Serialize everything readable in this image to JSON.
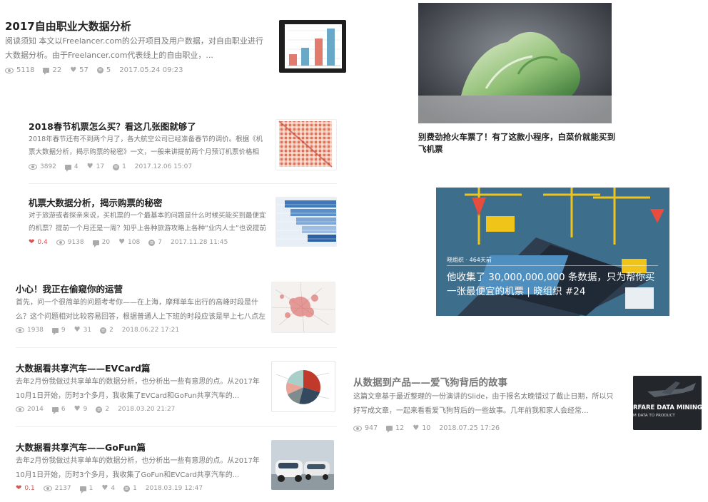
{
  "left_articles": [
    {
      "title": "2017自由职业大数据分析",
      "excerpt": "阅读须知 本文以Freelancer.com的公开项目及用户数据，对自由职业进行大数据分析。由于Freelancer.com代表线上的自由职业，...",
      "views": "5118",
      "comments": "22",
      "likes": "57",
      "shares": "5",
      "date": "2017.05.24 09:23"
    },
    {
      "title": "2018春节机票怎么买？看这几张图就够了",
      "excerpt": "2018年春节还有不到两个月了，各大航空公司已经准备春节的调价。根据《机票大数据分析，揭示购票的秘密》一文，一般来讲提前两个月预订机票价格相对较...",
      "views": "3892",
      "comments": "4",
      "likes": "17",
      "shares": "1",
      "date": "2017.12.06 15:07"
    },
    {
      "title": "机票大数据分析，揭示购票的秘密",
      "excerpt": "对于旅游或者探亲来说，买机票的一个最基本的问题是什么时候买能买到最便宜的机票？提前一个月还是一周？知乎上各种旅游攻略上各种“业内人士”也说提前一...",
      "hot": "0.4",
      "views": "9138",
      "comments": "20",
      "likes": "108",
      "shares": "7",
      "date": "2017.11.28 11:45"
    },
    {
      "title": "小心！我正在偷窥你的运营",
      "excerpt": "首先，问一个很简单的问题考考你——在上海，摩拜单车出行的高峰时段是什么？这个问题相对比较容易回答，根据普通人上下班的时段应该是早上七八点左右，下...",
      "views": "1938",
      "comments": "9",
      "likes": "31",
      "shares": "2",
      "date": "2018.06.22 17:21"
    },
    {
      "title": "大数据看共享汽车——EVCard篇",
      "excerpt": "去年2月份我做过共享单车的数据分析，也分析出一些有意思的点。从2017年10月1日开始，历时3个多月，我收集了EVCard和GoFun共享汽车的...",
      "views": "2014",
      "comments": "6",
      "likes": "9",
      "shares": "2",
      "date": "2018.03.20 21:27"
    },
    {
      "title": "大数据看共享汽车——GoFun篇",
      "excerpt": "去年2月份我做过共享单车的数据分析，也分析出一些有意思的点。从2017年10月1日开始，历时3个多月，我收集了GoFun和EVCard共享汽车的...",
      "hot": "0.1",
      "views": "2137",
      "comments": "1",
      "likes": "4",
      "shares": "1",
      "date": "2018.03.19 12:47"
    }
  ],
  "right_cabbage": {
    "title": "别费劲抢火车票了！有了这款小程序，白菜价就能买到飞机票"
  },
  "right_banner": {
    "meta": "晓组织 · 464天前",
    "title": "他收集了 30,000,000,000 条数据，只为帮你买一张最便宜的机票 | 晓组织 #24"
  },
  "right_article": {
    "title": "从数据到产品——爱飞狗背后的故事",
    "excerpt": "这篇文章基于最近整理的一份演讲的Slide，由于报名太晚错过了截止日期，所以只好写成文章，一起来看看爱飞狗背后的一些故事。几年前我和家人会经常...",
    "views": "947",
    "comments": "12",
    "likes": "10",
    "date": "2018.07.25 17:26",
    "thumb_line1": "RFARE DATA MINING",
    "thumb_line2": "M DATA TO PRODUCT"
  },
  "chart_thumb": {
    "ticks": [
      "",
      "",
      "",
      ""
    ],
    "labels": [
      "",
      ""
    ]
  },
  "colors": {
    "accent": "#d9534f",
    "bar1": "#e07b6e",
    "bar2": "#6aa8c7",
    "bar3": "#e07b6e",
    "bar4": "#6aa8c7"
  }
}
